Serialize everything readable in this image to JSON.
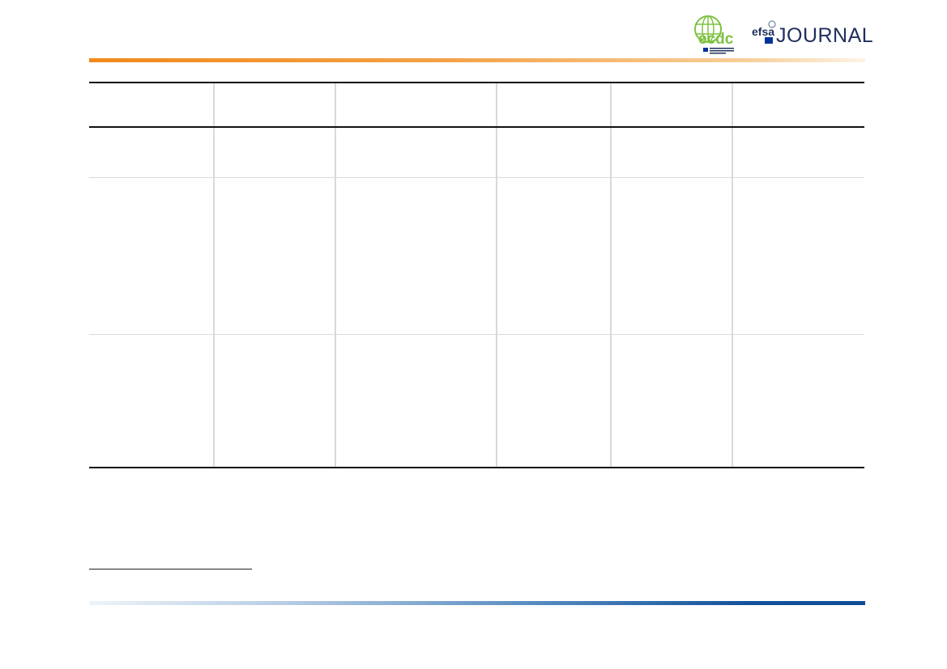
{
  "header": {
    "ecdc_logo": {
      "icon": "ecdc-globe-logo",
      "wordmark": "ecdc",
      "colors": {
        "globe": "#7dc242",
        "text": "#1f2f5c",
        "flag": "#003399"
      }
    },
    "efsa_logo": {
      "icon": "efsa-journal-logo",
      "wordmark": "efsa",
      "journal_label": "JOURNAL",
      "colors": {
        "text": "#1f2f5c",
        "flag": "#003399"
      }
    },
    "accent_bar_color": "#f08a1c"
  },
  "table": {
    "columns": [
      "",
      "",
      "",
      "",
      "",
      ""
    ],
    "rows": [
      [
        "",
        "",
        "",
        "",
        "",
        ""
      ],
      [
        "",
        "",
        "",
        "",
        "",
        ""
      ],
      [
        "",
        "",
        "",
        "",
        "",
        ""
      ]
    ]
  },
  "footer": {
    "accent_bar_color": "#0f4c96"
  }
}
